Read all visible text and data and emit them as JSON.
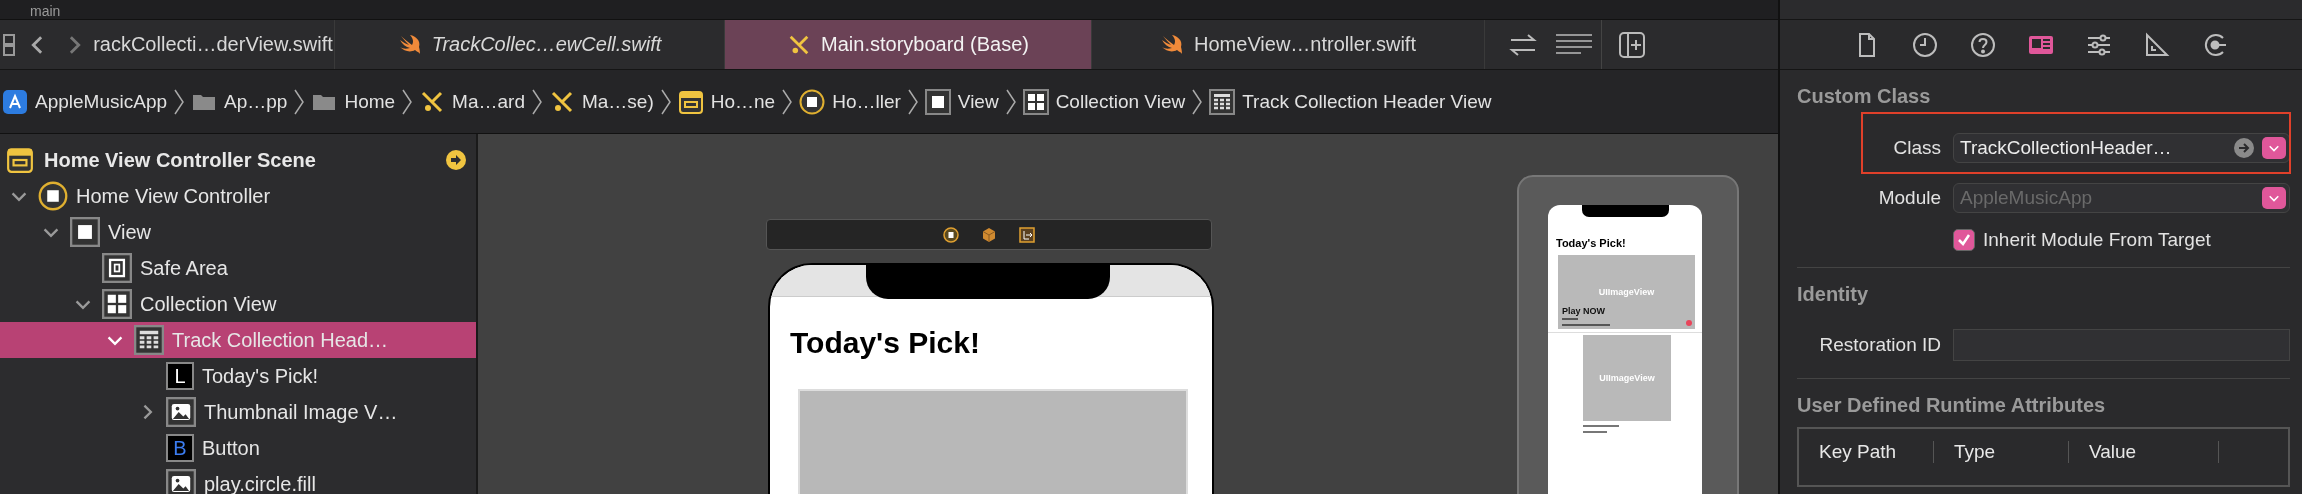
{
  "window": {
    "branch": "main"
  },
  "tabs": [
    {
      "label": "rackCollecti…derView.swift",
      "kind": "plain",
      "italic": false,
      "selected": false
    },
    {
      "label": "TrackCollec…ewCell.swift",
      "kind": "swift",
      "italic": true,
      "selected": false
    },
    {
      "label": "Main.storyboard (Base)",
      "kind": "storyboard",
      "italic": false,
      "selected": true
    },
    {
      "label": "HomeView…ntroller.swift",
      "kind": "swift",
      "italic": false,
      "selected": false
    }
  ],
  "breadcrumb": [
    {
      "label": "AppleMusicApp",
      "kind": "app"
    },
    {
      "label": "Ap…pp",
      "kind": "folder"
    },
    {
      "label": "Home",
      "kind": "folder"
    },
    {
      "label": "Ma…ard",
      "kind": "storyboard"
    },
    {
      "label": "Ma…se)",
      "kind": "storyboard"
    },
    {
      "label": "Ho…ne",
      "kind": "scene"
    },
    {
      "label": "Ho…ller",
      "kind": "controller"
    },
    {
      "label": "View",
      "kind": "view"
    },
    {
      "label": "Collection View",
      "kind": "collection"
    },
    {
      "label": "Track Collection Header View",
      "kind": "table"
    }
  ],
  "navigator": {
    "scene": {
      "title": "Home View Controller Scene"
    },
    "tree": [
      {
        "label": "Home View Controller",
        "kind": "controller",
        "expanded": true,
        "selected": false,
        "children": [
          {
            "label": "View",
            "kind": "view",
            "expanded": true,
            "selected": false,
            "children": [
              {
                "label": "Safe Area",
                "kind": "safe-area",
                "selected": false
              },
              {
                "label": "Collection View",
                "kind": "collection",
                "expanded": true,
                "selected": false,
                "children": [
                  {
                    "label": "Track Collection Head…",
                    "kind": "table",
                    "expanded": true,
                    "selected": true,
                    "children": [
                      {
                        "label": "Today's Pick!",
                        "kind": "label",
                        "badge": "L",
                        "selected": false
                      },
                      {
                        "label": "Thumbnail Image V…",
                        "kind": "image",
                        "expanded": false,
                        "selected": false
                      },
                      {
                        "label": "Button",
                        "kind": "button",
                        "badge": "B",
                        "selected": false
                      },
                      {
                        "label": "play.circle.fill",
                        "kind": "image",
                        "selected": false
                      }
                    ]
                  }
                ]
              }
            ]
          }
        ]
      }
    ]
  },
  "canvas": {
    "main_phone": {
      "title": "Today's Pick!"
    },
    "preview_phone": {
      "title": "Today's Pick!",
      "image_label": "UIImageView",
      "play_label": "Play NOW",
      "second_image_label": "UIImageView"
    }
  },
  "inspector": {
    "tabs": [
      {
        "kind": "file",
        "selected": false
      },
      {
        "kind": "history",
        "selected": false
      },
      {
        "kind": "help",
        "selected": false
      },
      {
        "kind": "identity",
        "selected": true
      },
      {
        "kind": "attributes",
        "selected": false
      },
      {
        "kind": "size",
        "selected": false
      },
      {
        "kind": "connections",
        "selected": false
      }
    ],
    "custom_class": {
      "heading": "Custom Class",
      "fields": [
        {
          "label": "Class",
          "value": "TrackCollectionHeader…",
          "disabled": false
        },
        {
          "label": "Module",
          "value": "AppleMusicApp",
          "disabled": true
        }
      ],
      "checkbox": {
        "label": "Inherit Module From Target",
        "checked": true
      }
    },
    "identity": {
      "heading": "Identity",
      "field_label": "Restoration ID"
    },
    "annotations": [
      {
        "kind": "frame"
      }
    ],
    "runtime": {
      "heading": "User Defined Runtime Attributes",
      "columns": [
        "Key Path",
        "Type",
        "Value"
      ]
    }
  }
}
